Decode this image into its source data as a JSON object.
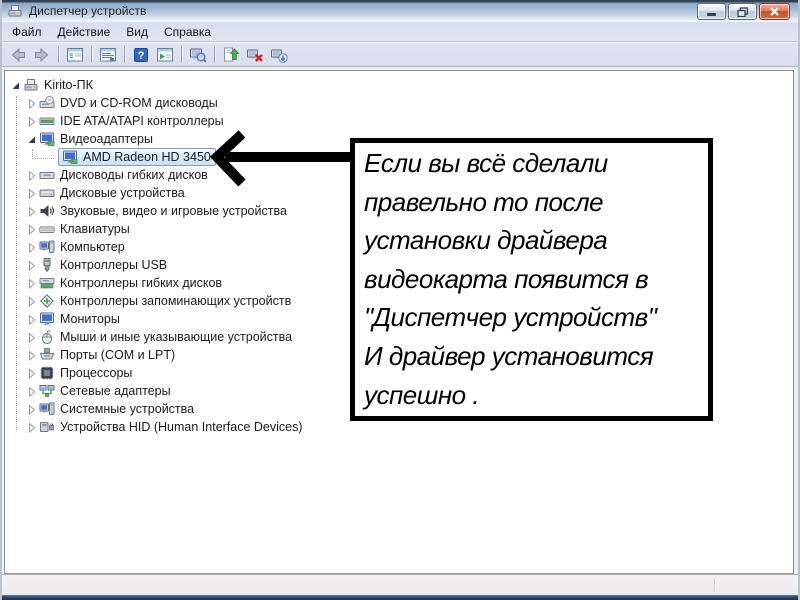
{
  "window": {
    "title": "Диспетчер устройств",
    "controls": {
      "minimize": "minimize-button",
      "restore": "restore-button",
      "close": "close-button"
    }
  },
  "menu": {
    "items": [
      {
        "label": "Файл"
      },
      {
        "label": "Действие"
      },
      {
        "label": "Вид"
      },
      {
        "label": "Справка"
      }
    ]
  },
  "toolbar": {
    "buttons": [
      {
        "icon": "back-icon"
      },
      {
        "icon": "forward-icon"
      },
      {
        "icon": "show-console-tree-icon"
      },
      {
        "icon": "properties-icon"
      },
      {
        "icon": "help-icon"
      },
      {
        "icon": "action-pane-icon"
      },
      {
        "icon": "search-computer-icon"
      },
      {
        "icon": "update-driver-icon"
      },
      {
        "icon": "uninstall-device-icon"
      },
      {
        "icon": "scan-hardware-changes-icon"
      }
    ]
  },
  "tree": {
    "items": [
      {
        "label": "Kirito-ПК",
        "level": 0,
        "state": "expanded",
        "icon": "computer-root-icon",
        "selected": false
      },
      {
        "label": "DVD и CD-ROM дисководы",
        "level": 1,
        "state": "collapsed",
        "icon": "cd-drive-icon",
        "selected": false
      },
      {
        "label": "IDE ATA/ATAPI контроллеры",
        "level": 1,
        "state": "collapsed",
        "icon": "ide-controller-icon",
        "selected": false
      },
      {
        "label": "Видеоадаптеры",
        "level": 1,
        "state": "expanded",
        "icon": "display-adapter-icon",
        "selected": false
      },
      {
        "label": "AMD Radeon HD 3450",
        "level": 2,
        "state": "none",
        "icon": "display-adapter-icon",
        "selected": true
      },
      {
        "label": "Дисководы гибких дисков",
        "level": 1,
        "state": "collapsed",
        "icon": "floppy-drive-icon",
        "selected": false
      },
      {
        "label": "Дисковые устройства",
        "level": 1,
        "state": "collapsed",
        "icon": "disk-drive-icon",
        "selected": false
      },
      {
        "label": "Звуковые, видео и игровые устройства",
        "level": 1,
        "state": "collapsed",
        "icon": "audio-device-icon",
        "selected": false
      },
      {
        "label": "Клавиатуры",
        "level": 1,
        "state": "collapsed",
        "icon": "keyboard-icon",
        "selected": false
      },
      {
        "label": "Компьютер",
        "level": 1,
        "state": "collapsed",
        "icon": "computer-icon",
        "selected": false
      },
      {
        "label": "Контроллеры USB",
        "level": 1,
        "state": "collapsed",
        "icon": "usb-controller-icon",
        "selected": false
      },
      {
        "label": "Контроллеры гибких дисков",
        "level": 1,
        "state": "collapsed",
        "icon": "floppy-controller-icon",
        "selected": false
      },
      {
        "label": "Контроллеры запоминающих устройств",
        "level": 1,
        "state": "collapsed",
        "icon": "storage-controller-icon",
        "selected": false
      },
      {
        "label": "Мониторы",
        "level": 1,
        "state": "collapsed",
        "icon": "monitor-icon",
        "selected": false
      },
      {
        "label": "Мыши и иные указывающие устройства",
        "level": 1,
        "state": "collapsed",
        "icon": "mouse-icon",
        "selected": false
      },
      {
        "label": "Порты (COM и LPT)",
        "level": 1,
        "state": "collapsed",
        "icon": "port-icon",
        "selected": false
      },
      {
        "label": "Процессоры",
        "level": 1,
        "state": "collapsed",
        "icon": "cpu-icon",
        "selected": false
      },
      {
        "label": "Сетевые адаптеры",
        "level": 1,
        "state": "collapsed",
        "icon": "network-adapter-icon",
        "selected": false
      },
      {
        "label": "Системные устройства",
        "level": 1,
        "state": "collapsed",
        "icon": "system-devices-icon",
        "selected": false
      },
      {
        "label": "Устройства HID (Human Interface Devices)",
        "level": 1,
        "state": "collapsed",
        "icon": "hid-device-icon",
        "selected": false
      }
    ]
  },
  "annotation": {
    "text": "Если вы всё сделали\nправельно то после\nустановки драйвера\nвидеокарта появится в\n\"Диспетчер устройств\"\nИ драйвер установится\nуспешно .",
    "arrow_color": "#000000"
  },
  "status_bar": {
    "text": ""
  },
  "colors": {
    "titlebar_top": "#8fabc9",
    "selection_border": "#7ba0c8",
    "selection_fill": "#c4e0f5",
    "close_button": "#c1502f",
    "help_icon_blue": "#2e66c6",
    "annotation_black": "#000000",
    "bottom_strip_navy": "#27466c"
  }
}
